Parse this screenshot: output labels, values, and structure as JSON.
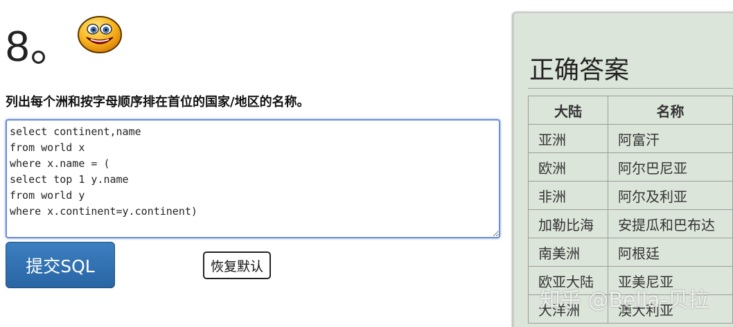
{
  "question": {
    "number": "8。",
    "text": "列出每个洲和按字母顺序排在首位的国家/地区的名称。"
  },
  "editor": {
    "sql": "select continent,name\nfrom world x\nwhere x.name = (\nselect top 1 y.name\nfrom world y\nwhere x.continent=y.continent)"
  },
  "actions": {
    "submit_label": "提交SQL",
    "reset_label": "恢复默认"
  },
  "answer": {
    "title": "正确答案",
    "columns": [
      "大陆",
      "名称"
    ],
    "rows": [
      [
        "亚洲",
        "阿富汗"
      ],
      [
        "欧洲",
        "阿尔巴尼亚"
      ],
      [
        "非洲",
        "阿尔及利亚"
      ],
      [
        "加勒比海",
        "安提瓜和巴布达"
      ],
      [
        "南美洲",
        "阿根廷"
      ],
      [
        "欧亚大陆",
        "亚美尼亚"
      ],
      [
        "大洋洲",
        "澳大利亚"
      ]
    ]
  },
  "watermark": "知乎 @Bella-贝拉",
  "icons": {
    "emoticon": "smiley-face-icon"
  },
  "colors": {
    "submit_button": "#2f6fae",
    "panel_background": "#dce5da",
    "editor_border": "#6b8fd1"
  }
}
